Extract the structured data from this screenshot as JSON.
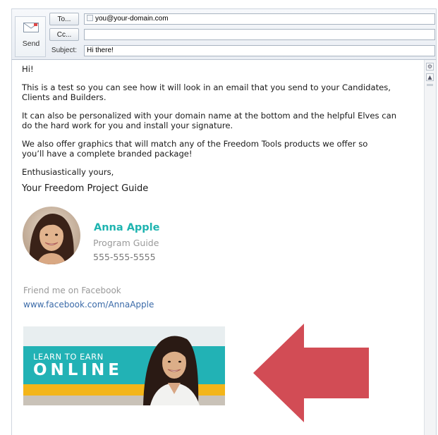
{
  "compose": {
    "send_label": "Send",
    "to_button": "To...",
    "cc_button": "Cc...",
    "subject_label": "Subject:",
    "to_value": "you@your-domain.com",
    "cc_value": "",
    "subject_value": "Hi there!"
  },
  "message": {
    "greeting": "Hi!",
    "para1": "This is a test so you can see how it will look in an email that you send to your Candidates, Clients and Builders.",
    "para2": "It can also be personalized with your domain name at the bottom and the helpful Elves can do the hard work for you and install your signature.",
    "para3_line1": "We also offer graphics that will match any of the Freedom Tools products we offer so",
    "para3_line2": "you’ll have a complete branded package!",
    "closing": "Enthusiastically yours,",
    "signoff": "Your Freedom Project Guide"
  },
  "signature": {
    "name": "Anna Apple",
    "title": "Program Guide",
    "phone": "555-555-5555",
    "facebook_label": "Friend me on Facebook",
    "facebook_link": "www.facebook.com/AnnaApple"
  },
  "banner": {
    "small_text": "LEARN TO EARN",
    "big_text": "ONLINE"
  },
  "colors": {
    "teal": "#1eb4b0",
    "arrow_red": "#d24c55",
    "banner_yellow": "#f3b519",
    "link_blue": "#3a6aa8"
  },
  "icons": [
    "send-icon",
    "contact-chip-icon",
    "scroll-options-icon",
    "scroll-up-icon"
  ]
}
